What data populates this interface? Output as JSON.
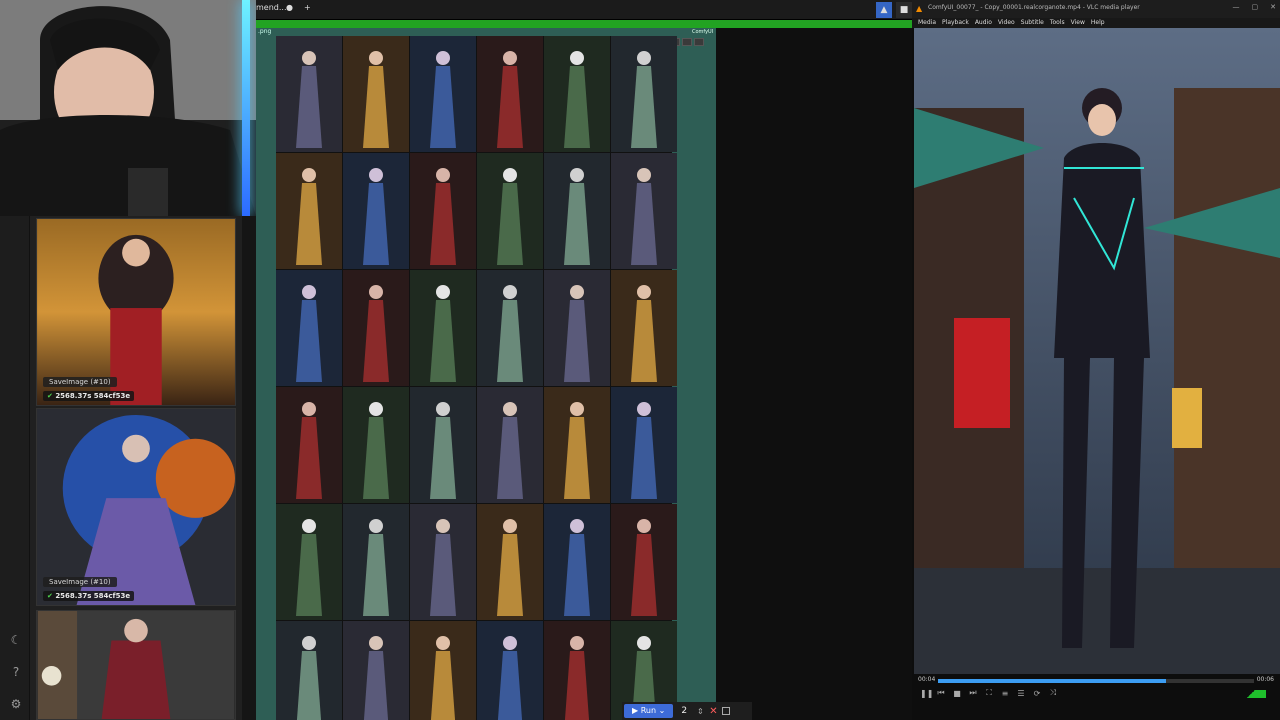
{
  "browser": {
    "tab_label": "mend...",
    "tab_close": "●",
    "new_tab": "+"
  },
  "comfy": {
    "node_tag": "ComfyUI",
    "queue_items": [
      {
        "label": "SaveImage (#10)",
        "time": "2568.37s 584cf53e"
      },
      {
        "label": "SaveImage (#10)",
        "time": "2568.37s 584cf53e"
      }
    ],
    "run_label": "Run",
    "run_count": "2"
  },
  "vlc": {
    "title": "ComfyUI_00077_ - Copy_00001.realcorganote.mp4 - VLC media player",
    "menu": [
      "Media",
      "Playback",
      "Audio",
      "Video",
      "Subtitle",
      "Tools",
      "View",
      "Help"
    ],
    "time_elapsed": "00:04",
    "time_total": "00:06",
    "progress_fraction": 0.72
  },
  "colors": {
    "accent_green": "#22a322",
    "run_blue": "#3d6bd8",
    "node_teal": "#2e5e55",
    "vlc_seek": "#3c9df2"
  }
}
